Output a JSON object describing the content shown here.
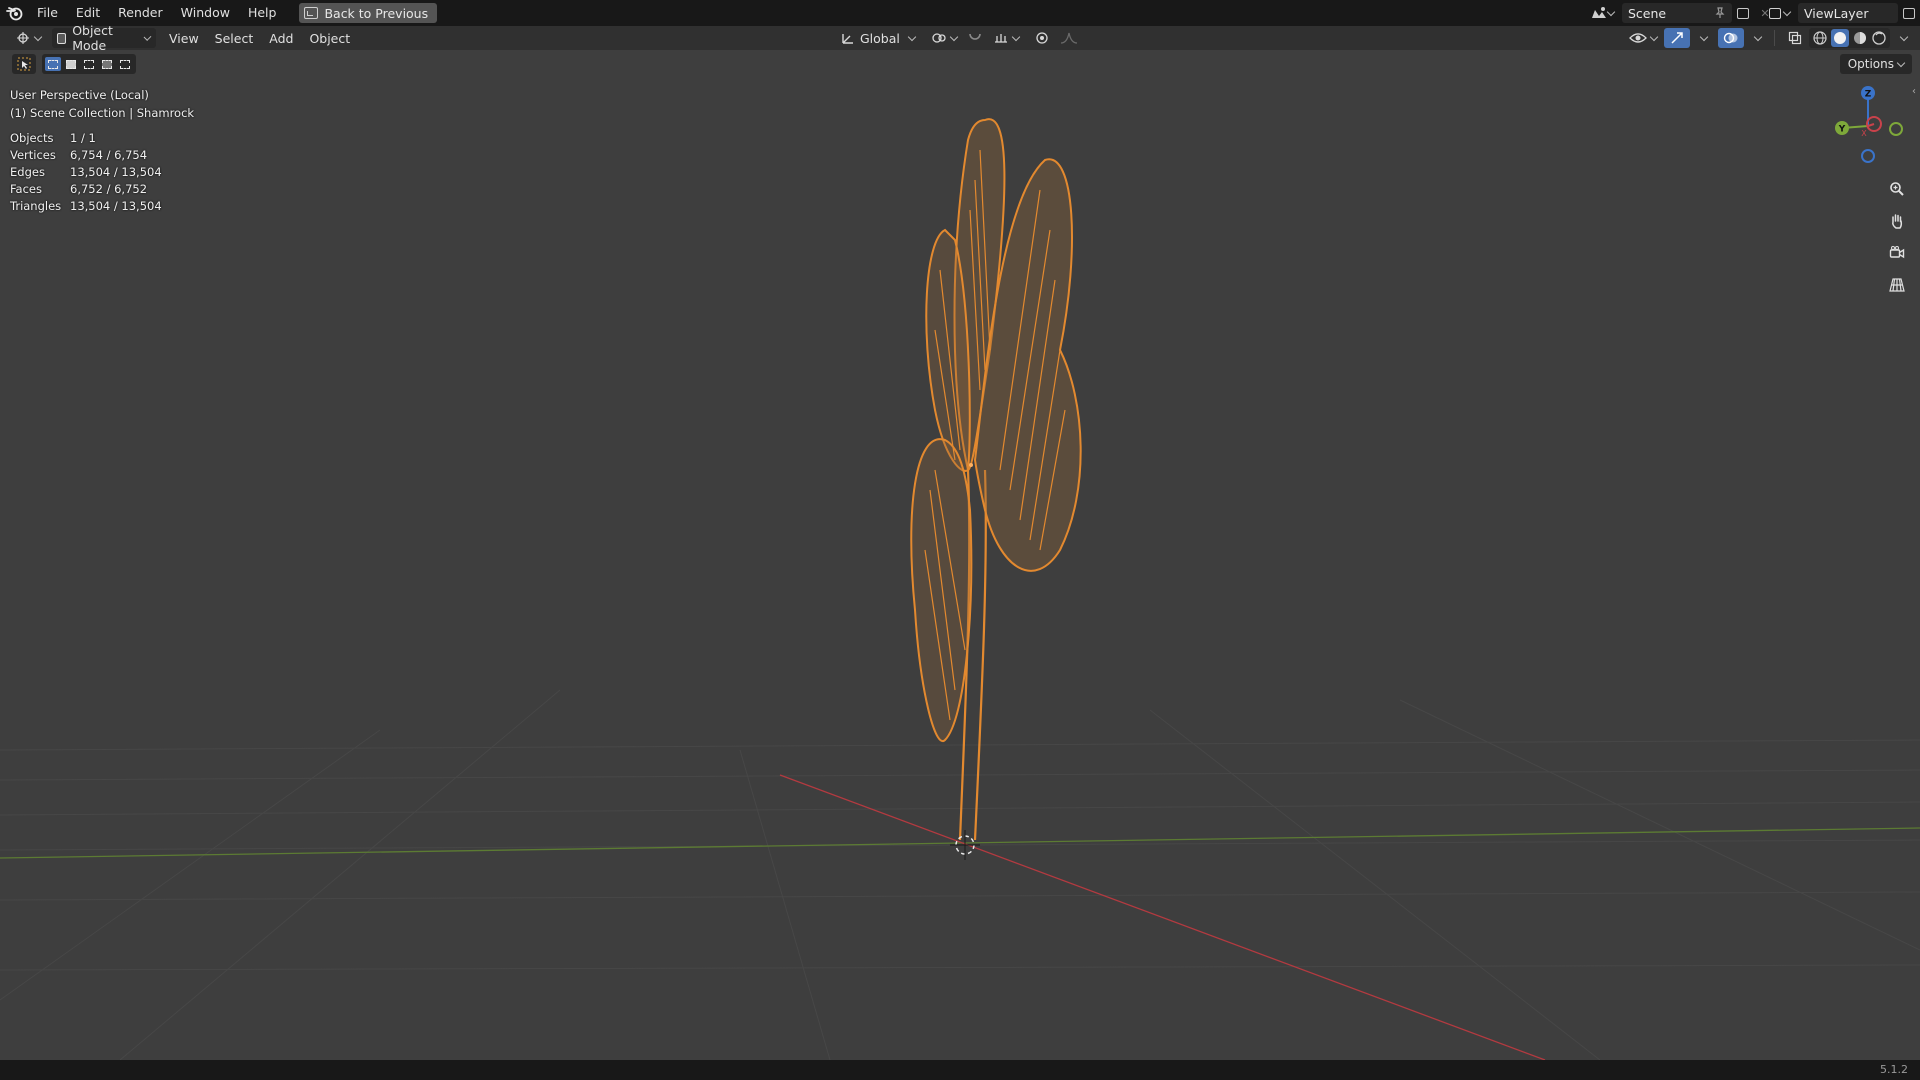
{
  "menus": [
    "File",
    "Edit",
    "Render",
    "Window",
    "Help"
  ],
  "back_button": "Back to Previous",
  "scene": {
    "name": "Scene"
  },
  "view_layer": {
    "name": "ViewLayer"
  },
  "header": {
    "mode": "Object Mode",
    "menus": [
      "View",
      "Select",
      "Add",
      "Object"
    ],
    "transform_orientation": "Global"
  },
  "options_label": "Options",
  "overlay": {
    "perspective": "User Perspective (Local)",
    "collection": "(1) Scene Collection | Shamrock"
  },
  "stats": [
    {
      "label": "Objects",
      "value": "1 / 1"
    },
    {
      "label": "Vertices",
      "value": "6,754 / 6,754"
    },
    {
      "label": "Edges",
      "value": "13,504 / 13,504"
    },
    {
      "label": "Faces",
      "value": "6,752 / 6,752"
    },
    {
      "label": "Triangles",
      "value": "13,504 / 13,504"
    }
  ],
  "gizmo_axes": [
    "Z",
    "Y",
    "X"
  ],
  "version": "5.1.2",
  "colors": {
    "selection": "#f5922e",
    "axis_x": "#c9424b",
    "axis_y": "#7ea83a",
    "axis_z": "#3a73c9"
  }
}
